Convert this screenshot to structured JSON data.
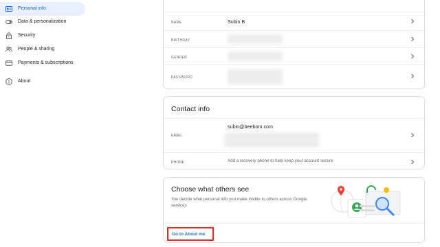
{
  "sidebar": {
    "items": [
      {
        "label": "Personal info",
        "icon": "id-card-icon",
        "active": true
      },
      {
        "label": "Data & personalization",
        "icon": "toggle-icon"
      },
      {
        "label": "Security",
        "icon": "lock-icon"
      },
      {
        "label": "People & sharing",
        "icon": "people-icon"
      },
      {
        "label": "Payments & subscriptions",
        "icon": "credit-card-icon"
      },
      {
        "label": "About",
        "icon": "info-icon"
      }
    ]
  },
  "basic_info": {
    "rows": [
      {
        "label": "NAME",
        "value": "Subin B"
      },
      {
        "label": "BIRTHDAY",
        "value": ""
      },
      {
        "label": "GENDER",
        "value": ""
      },
      {
        "label": "PASSWORD",
        "value": ""
      }
    ]
  },
  "contact_info": {
    "title": "Contact info",
    "email_label": "EMAIL",
    "email_value": "subin@beebom.com",
    "phone_label": "PHONE",
    "phone_value": "Add a recovery phone to help keep your account secure"
  },
  "others_see": {
    "title": "Choose what others see",
    "description": "You decide what personal info you make visible to others across Google services",
    "link_label": "Go to About me"
  },
  "colors": {
    "accent": "#1a73e8",
    "active_bg": "#e8f0fe",
    "highlight_border": "#d93025",
    "border": "#dadce0"
  }
}
